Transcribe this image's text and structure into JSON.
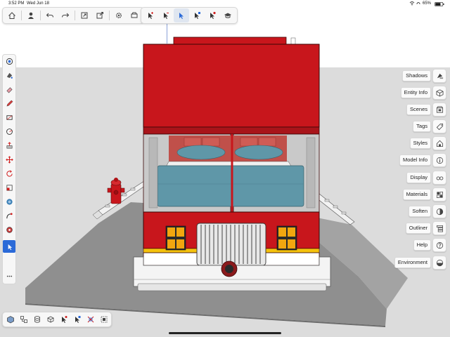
{
  "status_bar": {
    "time": "3:52 PM",
    "date": "Wed Jun 18",
    "battery": "65%"
  },
  "top_toolbar": {
    "group1_icons": [
      "home-icon",
      "user-icon",
      "undo-icon",
      "redo-icon",
      "export-icon",
      "share-icon",
      "settings-icon",
      "display-icon"
    ],
    "group2_icons": [
      "select-plus-icon",
      "select-minus-icon",
      "select-icon",
      "select-toggle-icon",
      "select-x-icon",
      "graduation-cap-icon"
    ]
  },
  "right_panels": [
    {
      "label": "Shadows",
      "icon": "shadows-icon"
    },
    {
      "label": "Entity Info",
      "icon": "cube-icon"
    },
    {
      "label": "Scenes",
      "icon": "scenes-icon"
    },
    {
      "label": "Tags",
      "icon": "tag-icon"
    },
    {
      "label": "Styles",
      "icon": "house-icon"
    },
    {
      "label": "Model Info",
      "icon": "info-icon"
    },
    {
      "label": "Display",
      "icon": "glasses-icon"
    },
    {
      "label": "Materials",
      "icon": "materials-icon"
    },
    {
      "label": "Soften",
      "icon": "soften-icon"
    },
    {
      "label": "Outliner",
      "icon": "outliner-icon"
    },
    {
      "label": "Help",
      "icon": "help-icon"
    },
    {
      "label": "Environment",
      "icon": "environment-icon"
    }
  ],
  "left_tools": [
    "orbit-icon",
    "paint-icon",
    "eraser-icon",
    "pencil-icon",
    "rectangle-icon",
    "circle-icon",
    "push-pull-icon",
    "move-icon",
    "rotate-icon",
    "scale-icon",
    "offset-icon",
    "follow-me-icon",
    "tape-measure-icon",
    "select-arrow-icon",
    "more-icon"
  ],
  "bottom_tools": [
    "component-icon",
    "layers-icon",
    "database-icon",
    "group-icon",
    "select-plus-icon",
    "select-minus-icon",
    "x-axes-icon",
    "section-icon"
  ],
  "colors": {
    "accent": "#2b6ad8",
    "truck_red": "#c8161c",
    "toolbar_bg": "#f7f7f7"
  }
}
